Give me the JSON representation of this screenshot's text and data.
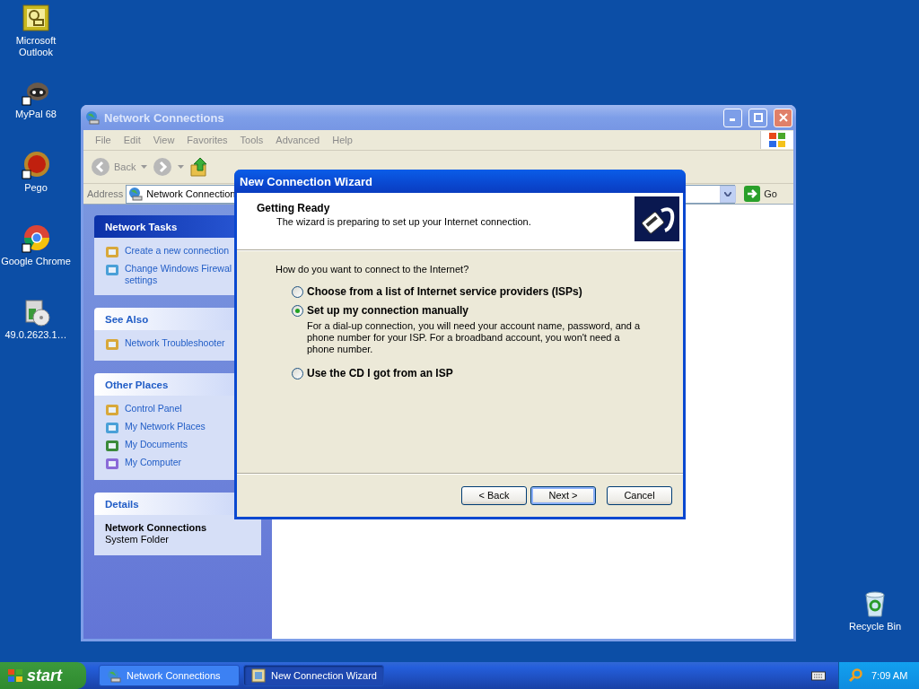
{
  "desktop_icons": [
    {
      "label": "Microsoft Outlook"
    },
    {
      "label": "MyPal 68"
    },
    {
      "label": "Pego"
    },
    {
      "label": "Google Chrome"
    },
    {
      "label": "49.0.2623.1…"
    },
    {
      "label": "Recycle Bin"
    }
  ],
  "explorer": {
    "title": "Network Connections",
    "active": false,
    "menu": [
      "File",
      "Edit",
      "View",
      "Favorites",
      "Tools",
      "Advanced",
      "Help"
    ],
    "back_label": "Back",
    "address_label": "Address",
    "address_value": "Network Connection",
    "go_label": "Go",
    "panels": [
      {
        "title": "Network Tasks",
        "highlighted": true,
        "items": [
          {
            "lines": [
              "Create a new connection"
            ]
          },
          {
            "lines": [
              "Change Windows Firewal",
              "settings"
            ]
          }
        ]
      },
      {
        "title": "See Also",
        "highlighted": false,
        "items": [
          {
            "lines": [
              "Network Troubleshooter"
            ]
          }
        ]
      },
      {
        "title": "Other Places",
        "highlighted": false,
        "items": [
          {
            "lines": [
              "Control Panel"
            ]
          },
          {
            "lines": [
              "My Network Places"
            ]
          },
          {
            "lines": [
              "My Documents"
            ]
          },
          {
            "lines": [
              "My Computer"
            ]
          }
        ]
      }
    ],
    "details": {
      "title": "Details",
      "name": "Network Connections",
      "type": "System Folder"
    }
  },
  "dialog": {
    "title": "New Connection Wizard",
    "active": true,
    "heading": "Getting Ready",
    "subheading": "The wizard is preparing to set up your Internet connection.",
    "question": "How do you want to connect to the Internet?",
    "options": [
      {
        "label": "Choose from a list of Internet service providers (ISPs)",
        "selected": false
      },
      {
        "label": "Set up my connection manually",
        "selected": true,
        "description": "For a dial-up connection, you will need your account name, password, and a phone number for your ISP. For a broadband account, you won't need a phone number."
      },
      {
        "label": "Use the CD I got from an ISP",
        "selected": false
      }
    ],
    "buttons": [
      {
        "label": "< Back",
        "default": false
      },
      {
        "label": "Next >",
        "default": true
      },
      {
        "label": "Cancel",
        "default": false
      }
    ]
  },
  "taskbar": {
    "start": "start",
    "tasks": [
      {
        "label": "Network Connections",
        "selected": false
      },
      {
        "label": "New Connection Wizard",
        "selected": true
      }
    ],
    "clock": "7:09 AM"
  }
}
